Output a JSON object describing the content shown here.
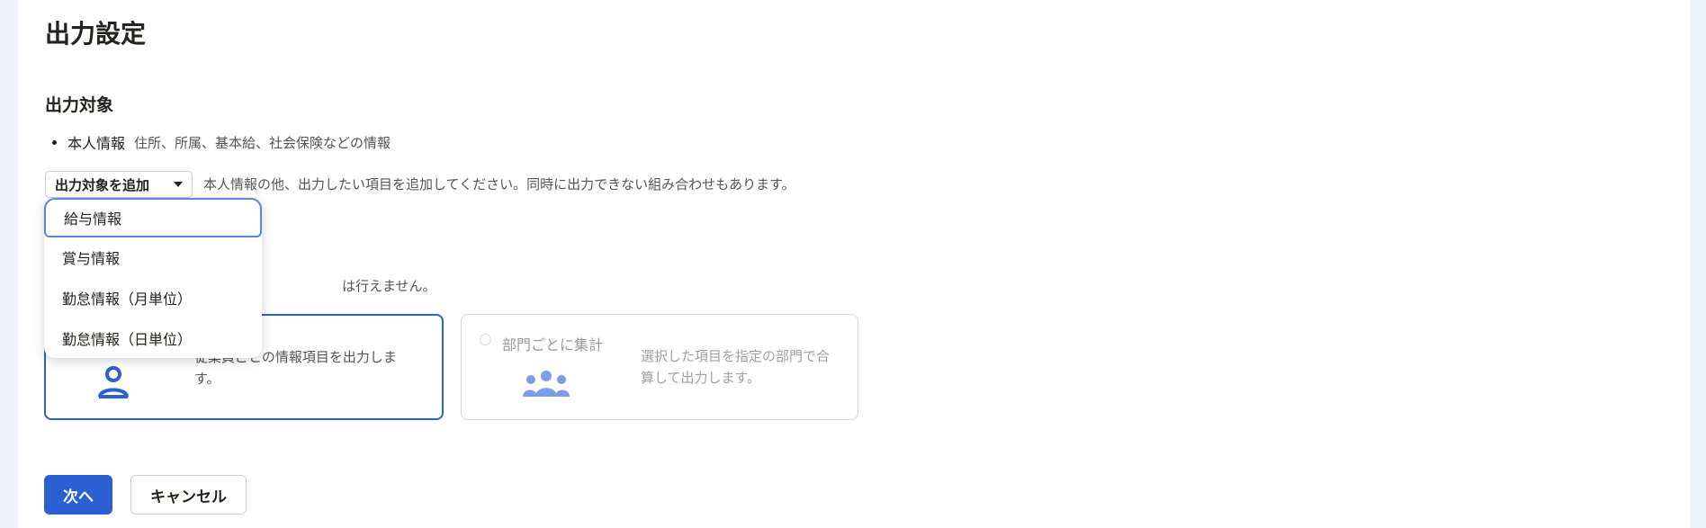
{
  "page": {
    "title": "出力設定"
  },
  "output_target": {
    "section_title": "出力対象",
    "items": [
      {
        "label": "本人情報",
        "description": "住所、所属、基本給、社会保険などの情報"
      }
    ],
    "add_button_label": "出力対象を追加",
    "add_hint": "本人情報の他、出力したい項目を追加してください。同時に出力できない組み合わせもあります。"
  },
  "dropdown": {
    "options": [
      "給与情報",
      "賞与情報",
      "勤怠情報（月単位）",
      "勤怠情報（日単位）"
    ]
  },
  "aggregation": {
    "note_fragment": "は行えません。",
    "employee_card": {
      "description": "従業員ごとの情報項目を出力します。"
    },
    "department_card": {
      "title": "部門ごとに集計",
      "description": "選択した項目を指定の部門で合算して出力します。"
    }
  },
  "actions": {
    "next_label": "次へ",
    "cancel_label": "キャンセル"
  },
  "colors": {
    "accent": "#2b5fd2",
    "background": "#eef2fb",
    "text": "#23221f"
  }
}
